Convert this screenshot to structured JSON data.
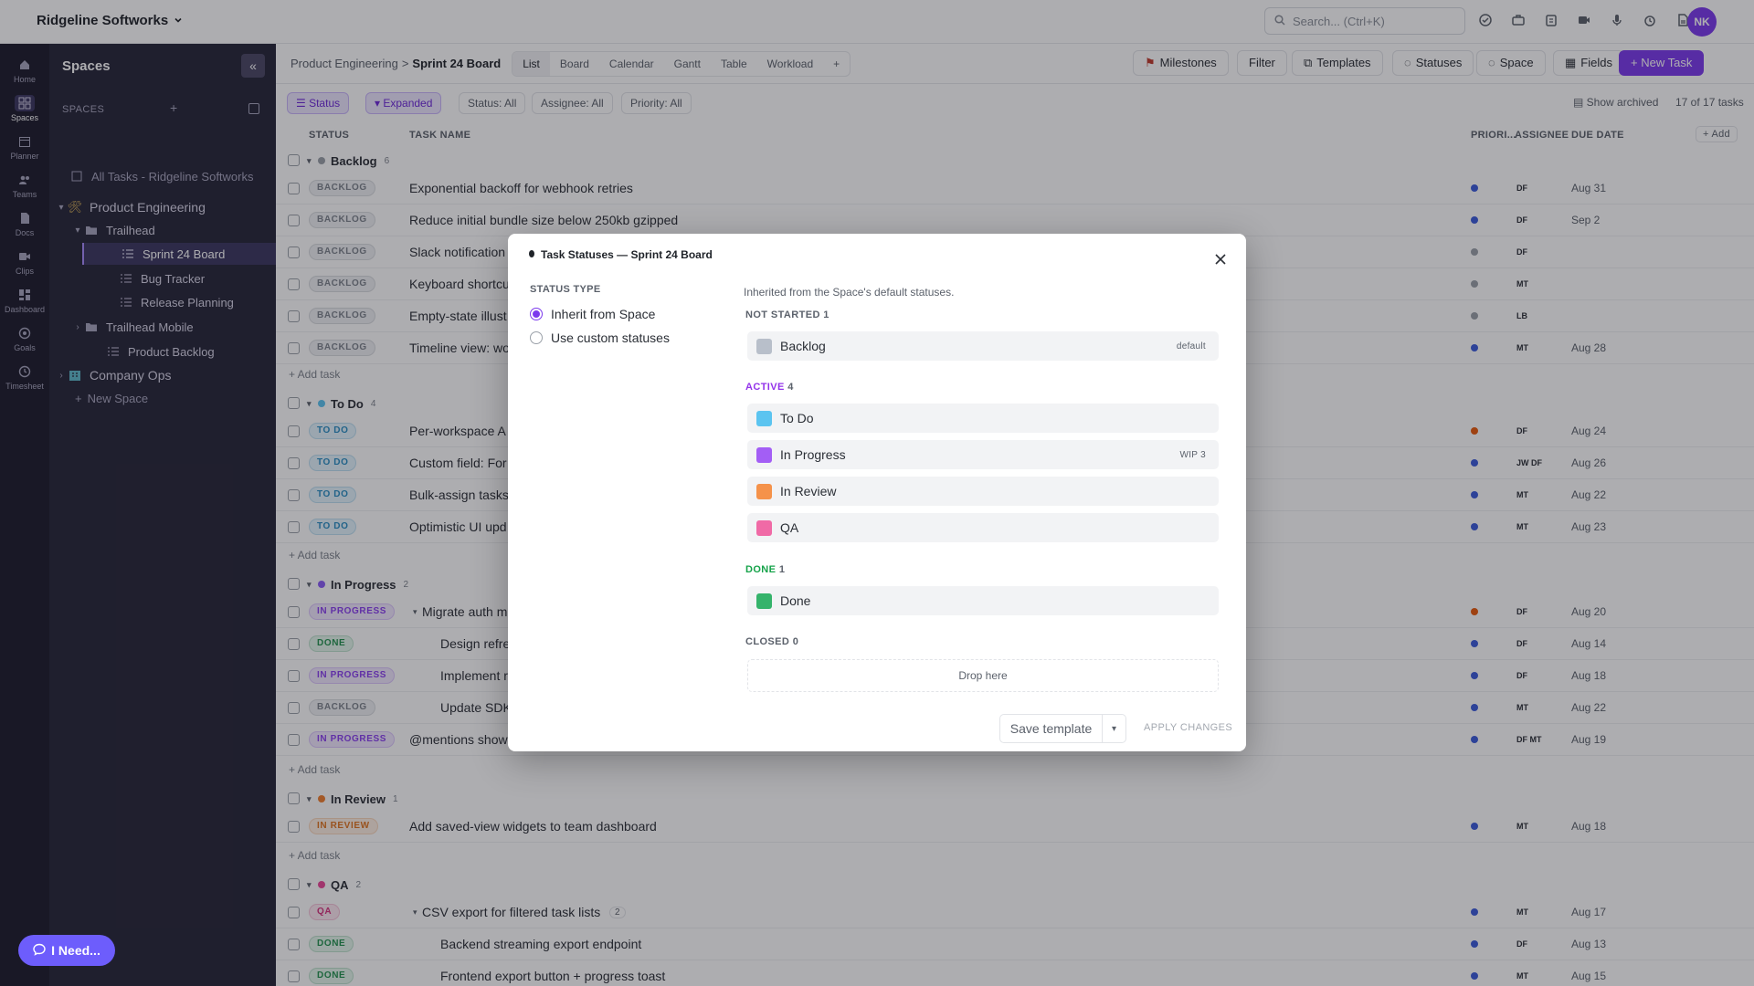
{
  "app": {
    "workspace": "Ridgeline Softworks",
    "search_placeholder": "Search... (Ctrl+K)",
    "avatar": "NK"
  },
  "rail": [
    {
      "label": "Home",
      "icon": "home-icon"
    },
    {
      "label": "Spaces",
      "icon": "spaces-icon"
    },
    {
      "label": "Planner",
      "icon": "planner-icon"
    },
    {
      "label": "Teams",
      "icon": "teams-icon"
    },
    {
      "label": "Docs",
      "icon": "docs-icon"
    },
    {
      "label": "Clips",
      "icon": "clips-icon"
    },
    {
      "label": "Dashboard",
      "icon": "dashboard-icon"
    },
    {
      "label": "Goals",
      "icon": "goals-icon"
    },
    {
      "label": "Timesheet",
      "icon": "timesheet-icon"
    }
  ],
  "sidebar": {
    "title": "Spaces",
    "spaces_label": "SPACES",
    "all_tasks": "All Tasks - Ridgeline Softworks",
    "items": [
      {
        "label": "Product Engineering"
      },
      {
        "label": "Trailhead"
      },
      {
        "label": "Sprint 24 Board"
      },
      {
        "label": "Bug Tracker"
      },
      {
        "label": "Release Planning"
      },
      {
        "label": "Trailhead Mobile"
      },
      {
        "label": "Product Backlog"
      },
      {
        "label": "Company Ops"
      },
      {
        "label": "New Space"
      }
    ]
  },
  "header": {
    "crumb_parent": "Product Engineering",
    "crumb_sep": ">",
    "crumb_current": "Sprint 24 Board",
    "tabs": [
      "List",
      "Board",
      "Calendar",
      "Gantt",
      "Table",
      "Workload",
      "+"
    ],
    "buttons": {
      "milestones": "Milestones",
      "filter": "Filter",
      "templates": "Templates",
      "statuses": "Statuses",
      "space": "Space",
      "fields": "Fields",
      "new_task": "+ New Task"
    }
  },
  "filters": {
    "status": "Status",
    "expanded": "Expanded",
    "status_all": "Status: All",
    "assignee_all": "Assignee: All",
    "priority_all": "Priority: All",
    "show_archived": "Show archived",
    "count": "17 of 17 tasks"
  },
  "columns": {
    "status": "STATUS",
    "task_name": "TASK NAME",
    "priority": "PRIORI...",
    "assignee": "ASSIGNEE",
    "due_date": "DUE DATE",
    "add": "+ Add"
  },
  "groups": [
    {
      "name": "Backlog",
      "count": "6"
    },
    {
      "name": "To Do",
      "count": "4"
    },
    {
      "name": "In Progress",
      "count": "2"
    },
    {
      "name": "In Review",
      "count": "1"
    },
    {
      "name": "QA",
      "count": "2"
    }
  ],
  "add_task": "+ Add task",
  "rows": [
    {
      "status": "BACKLOG",
      "name": "Exponential backoff for webhook retries",
      "assignee": "DF",
      "due": "Aug 31"
    },
    {
      "status": "BACKLOG",
      "name": "Reduce initial bundle size below 250kb gzipped",
      "assignee": "DF",
      "due": "Sep 2"
    },
    {
      "status": "BACKLOG",
      "name": "Slack notification",
      "assignee": "DF",
      "due": ""
    },
    {
      "status": "BACKLOG",
      "name": "Keyboard shortcu",
      "assignee": "MT",
      "due": ""
    },
    {
      "status": "BACKLOG",
      "name": "Empty-state illust",
      "assignee": "LB",
      "due": ""
    },
    {
      "status": "BACKLOG",
      "name": "Timeline view: wo",
      "assignee": "MT",
      "due": "Aug 28"
    },
    {
      "status": "TO DO",
      "name": "Per-workspace A",
      "assignee": "DF",
      "due": "Aug 24"
    },
    {
      "status": "TO DO",
      "name": "Custom field: For",
      "assignee": "JW DF",
      "due": "Aug 26"
    },
    {
      "status": "TO DO",
      "name": "Bulk-assign tasks",
      "assignee": "MT",
      "due": "Aug 22"
    },
    {
      "status": "TO DO",
      "name": "Optimistic UI upd",
      "assignee": "MT",
      "due": "Aug 23"
    },
    {
      "status": "IN PROGRESS",
      "name": "Migrate auth m",
      "assignee": "DF",
      "due": "Aug 20"
    },
    {
      "status": "DONE",
      "name": "Design refre",
      "assignee": "DF",
      "due": "Aug 14"
    },
    {
      "status": "IN PROGRESS",
      "name": "Implement r",
      "assignee": "DF",
      "due": "Aug 18"
    },
    {
      "status": "BACKLOG",
      "name": "Update SDK",
      "assignee": "MT",
      "due": "Aug 22"
    },
    {
      "status": "IN PROGRESS",
      "name": "@mentions show",
      "assignee": "DF MT",
      "due": "Aug 19"
    },
    {
      "status": "IN REVIEW",
      "name": "Add saved-view widgets to team dashboard",
      "assignee": "MT",
      "due": "Aug 18"
    },
    {
      "status": "QA",
      "name": "CSV export for filtered task lists",
      "subcount": "2",
      "assignee": "MT",
      "due": "Aug 17"
    },
    {
      "status": "DONE",
      "name": "Backend streaming export endpoint",
      "assignee": "DF",
      "due": "Aug 13"
    },
    {
      "status": "DONE",
      "name": "Frontend export button + progress toast",
      "assignee": "MT",
      "due": "Aug 15"
    }
  ],
  "help_button": "I Need...",
  "modal": {
    "title": "Task Statuses — Sprint 24 Board",
    "status_type_label": "STATUS TYPE",
    "option_inherit": "Inherit from Space",
    "option_custom": "Use custom statuses",
    "inherited_note": "Inherited from the Space's default statuses.",
    "sections": {
      "not_started": {
        "label": "NOT STARTED",
        "count": "1"
      },
      "active": {
        "label": "ACTIVE",
        "count": "4"
      },
      "done": {
        "label": "DONE",
        "count": "1"
      },
      "closed": {
        "label": "CLOSED",
        "count": "0"
      }
    },
    "statuses": [
      {
        "name": "Backlog",
        "tag": "default",
        "color": "#b8bfca"
      },
      {
        "name": "To Do",
        "tag": "",
        "color": "#5bc4f0"
      },
      {
        "name": "In Progress",
        "tag": "WIP 3",
        "color": "#a35ef5"
      },
      {
        "name": "In Review",
        "tag": "",
        "color": "#f5924a"
      },
      {
        "name": "QA",
        "tag": "",
        "color": "#f06aa6"
      },
      {
        "name": "Done",
        "tag": "",
        "color": "#35b36b"
      }
    ],
    "drop_here": "Drop here",
    "save_template": "Save template",
    "apply_changes": "APPLY CHANGES"
  },
  "colors": {
    "accent": "#7c3aed",
    "rail": "#1c1b2b",
    "sidebar": "#262538"
  }
}
